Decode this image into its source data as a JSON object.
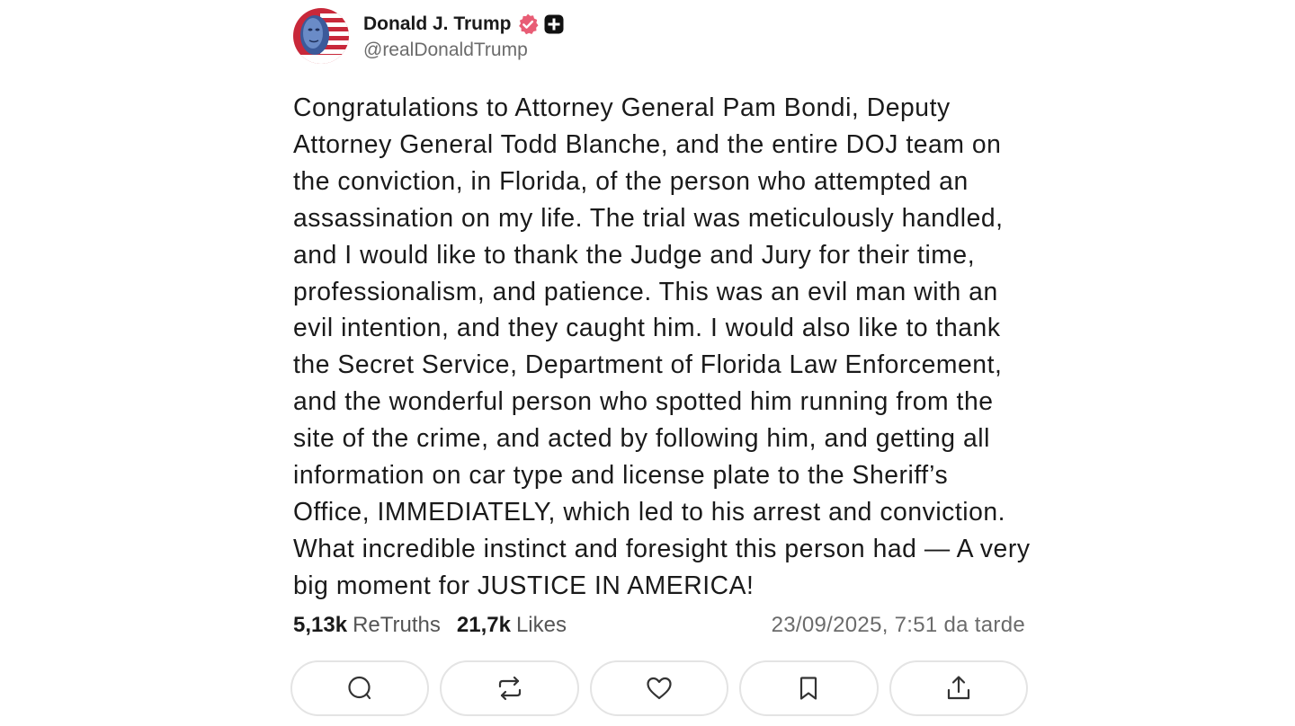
{
  "post": {
    "author": {
      "display_name": "Donald J. Trump",
      "handle": "@realDonaldTrump",
      "verified_icon": "verified-badge-icon",
      "badge_icon": "plus-badge-icon",
      "verified_color": "#e85d75"
    },
    "body": "Congratulations to Attorney General Pam Bondi, Deputy Attorney General Todd Blanche, and the entire DOJ team on the conviction, in Florida, of the person who attempted an assassination on my life. The trial was meticulously handled, and I would like to thank the Judge and Jury for their time, professionalism, and patience. This was an evil man with an evil intention, and they caught him. I would also like to thank the Secret Service, Department of Florida Law Enforcement, and the wonderful person who spotted him running from the site of the crime, and acted by following him, and getting all information on car type and license plate to the Sheriff’s Office, IMMEDIATELY, which led to his arrest and conviction. What incredible instinct and foresight this person had — A very big moment for JUSTICE IN AMERICA!",
    "stats": {
      "retruths_count": "5,13k",
      "retruths_label": "ReTruths",
      "likes_count": "21,7k",
      "likes_label": "Likes"
    },
    "timestamp": "23/09/2025, 7:51 da tarde",
    "actions": [
      {
        "name": "reply",
        "icon": "comment-icon"
      },
      {
        "name": "retruth",
        "icon": "repost-icon"
      },
      {
        "name": "like",
        "icon": "heart-icon"
      },
      {
        "name": "bookmark",
        "icon": "bookmark-icon"
      },
      {
        "name": "share",
        "icon": "share-icon"
      }
    ]
  }
}
